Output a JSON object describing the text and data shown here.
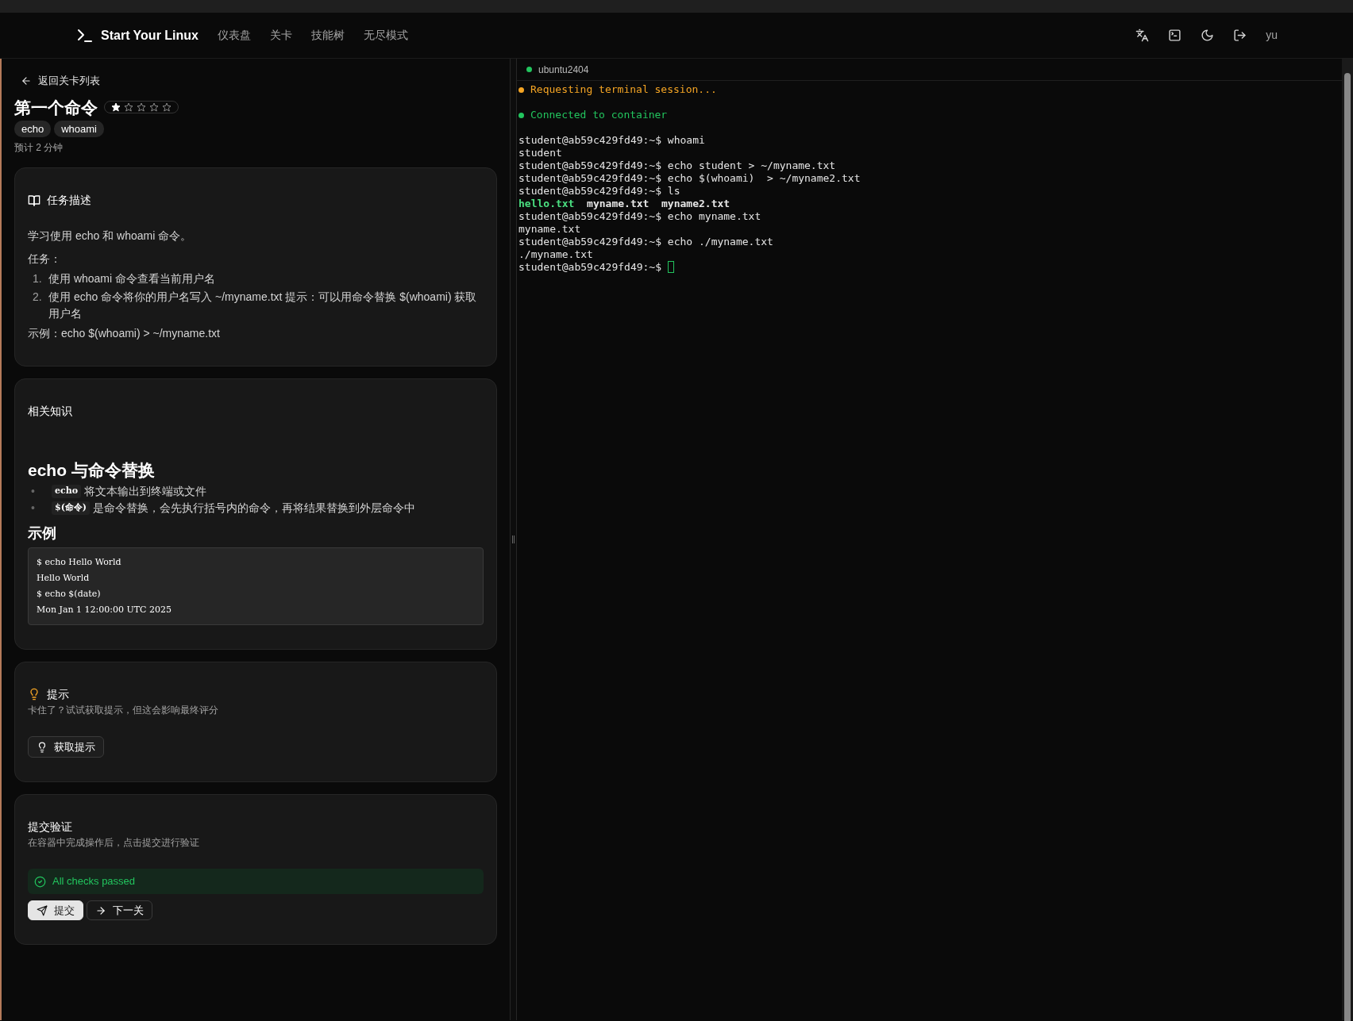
{
  "nav": {
    "brand": "Start Your Linux",
    "links": [
      {
        "label": "仪表盘",
        "selected": false
      },
      {
        "label": "关卡",
        "selected": false
      },
      {
        "label": "技能树",
        "selected": false
      },
      {
        "label": "无尽模式",
        "selected": false
      }
    ],
    "user": "yu"
  },
  "level": {
    "back": "返回关卡列表",
    "title": "第一个命令",
    "stars": 1,
    "tags": [
      "echo",
      "whoami"
    ],
    "estimate": "预计 2 分钟"
  },
  "task_card": {
    "title": "任务描述",
    "intro": "学习使用 echo 和 whoami 命令。",
    "tasks_label": "任务：",
    "steps": [
      {
        "marker": "1.",
        "text": "使用 whoami 命令查看当前用户名"
      },
      {
        "marker": "2.",
        "text": "使用 echo 命令将你的用户名写入 ~/myname.txt 提示：可以用命令替换 $(whoami) 获取用户名"
      }
    ],
    "example": "示例：echo $(whoami) > ~/myname.txt"
  },
  "knowledge_card": {
    "title": "相关知识",
    "heading": "echo 与命令替换",
    "bullets": [
      {
        "marker": "•",
        "code": "echo",
        "text": "将文本输出到终端或文件"
      },
      {
        "marker": "•",
        "code": "$(命令)",
        "text": "是命令替换，会先执行括号内的命令，再将结果替换到外层命令中"
      }
    ],
    "example_heading": "示例",
    "code_lines": [
      "$ echo Hello World",
      "Hello World",
      "$ echo $(date)",
      "Mon Jan 1 12:00:00 UTC 2025"
    ]
  },
  "hint_card": {
    "title": "提示",
    "description": "卡住了？试试获取提示，但这会影响最终评分",
    "button": "获取提示"
  },
  "submit_card": {
    "title": "提交验证",
    "description": "在容器中完成操作后，点击提交进行验证",
    "result": {
      "text": "All checks passed",
      "passed": true
    },
    "buttons": [
      {
        "label": "提交",
        "kind": "submit"
      },
      {
        "label": "下一关",
        "kind": "next"
      }
    ]
  },
  "terminal": {
    "tab": {
      "label": "ubuntu2404",
      "color": "#22c55e"
    },
    "lines": [
      {
        "kind": "status",
        "text": "Requesting terminal session...",
        "color": "#f5a524"
      },
      {
        "kind": "blank"
      },
      {
        "kind": "status",
        "text": "Connected to container",
        "color": "#22c55e"
      },
      {
        "kind": "blank"
      },
      {
        "kind": "prompt",
        "prompt": "student@ab59c429fd49:~$",
        "command": "whoami"
      },
      {
        "kind": "output",
        "text": "student"
      },
      {
        "kind": "prompt",
        "prompt": "student@ab59c429fd49:~$",
        "command": "echo student > ~/myname.txt"
      },
      {
        "kind": "prompt",
        "prompt": "student@ab59c429fd49:~$",
        "command": "echo $(whoami)  > ~/myname2.txt"
      },
      {
        "kind": "prompt",
        "prompt": "student@ab59c429fd49:~$",
        "command": "ls"
      },
      {
        "kind": "files",
        "files": [
          {
            "name": "hello.txt",
            "color": "#4ade80"
          },
          {
            "name": "myname.txt",
            "color": "#e5e5e5"
          },
          {
            "name": "myname2.txt",
            "color": "#e5e5e5"
          }
        ]
      },
      {
        "kind": "prompt",
        "prompt": "student@ab59c429fd49:~$",
        "command": "echo myname.txt"
      },
      {
        "kind": "output",
        "text": "myname.txt"
      },
      {
        "kind": "prompt",
        "prompt": "student@ab59c429fd49:~$",
        "command": "echo ./myname.txt"
      },
      {
        "kind": "output",
        "text": "./myname.txt"
      },
      {
        "kind": "prompt",
        "prompt": "student@ab59c429fd49:~$",
        "cursor": true
      }
    ]
  }
}
